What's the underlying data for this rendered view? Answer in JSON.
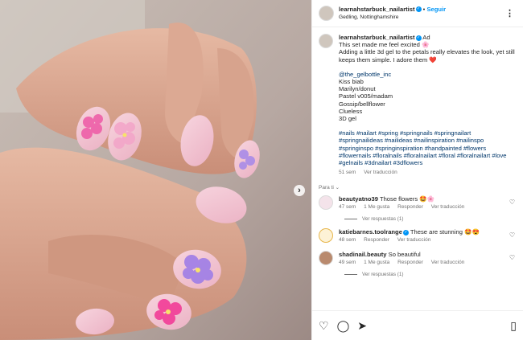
{
  "header": {
    "username": "learnahstarbuck_nailartist",
    "follow_label": "Seguir",
    "location": "Gedling, Nottinghamshire",
    "more_icon": "more-icon"
  },
  "caption": {
    "username": "learnahstarbuck_nailartist",
    "ad_label": "Ad",
    "lines": [
      "This set made me feel excited 🌸",
      "Adding a little 3d gel to the petals really elevates the look, yet still keeps them simple. I adore them ❤️"
    ],
    "mention": "@the_gelbottle_inc",
    "products": [
      "Kiss biab",
      "Marilyn/donut",
      "Pastel v005/madam",
      "Gossip/bellflower",
      "Clueless",
      "3D gel"
    ],
    "hashtags": "#nails #nailart #spring #springnails #springnailart #springnailideas #nailideas #nailinspiration #nailinspo #springinspo #springinspiration #handpainted #flowers #flowernails #floralnails #floralnailart #floral #floralnailart #love #gelnails #3dnailart #3dflowers",
    "time": "51 sem",
    "translate": "Ver traducción"
  },
  "for_you_label": "Para ti",
  "comments": [
    {
      "username": "beautyatno39",
      "text": "Those flowers 🤩🌸",
      "time": "47 sem",
      "likes": "1 Me gusta",
      "reply": "Responder",
      "translate": "Ver traducción",
      "replies": "Ver respuestas (1)"
    },
    {
      "username": "katiebarnes.toolrange",
      "text": "These are stunning 🤩😍",
      "time": "48 sem",
      "reply": "Responder",
      "translate": "Ver traducción"
    },
    {
      "username": "shadinail.beauty",
      "text": "So beautiful",
      "time": "49 sem",
      "likes": "1 Me gusta",
      "reply": "Responder",
      "translate": "Ver traducción",
      "replies": "Ver respuestas (1)"
    }
  ],
  "actions": {
    "like": "♡",
    "comment": "◯",
    "share": "➤",
    "save": "▯"
  },
  "media": {
    "next_glyph": "›"
  },
  "colors": {
    "link": "#00376b",
    "follow": "#0095f6",
    "muted": "#737373"
  }
}
